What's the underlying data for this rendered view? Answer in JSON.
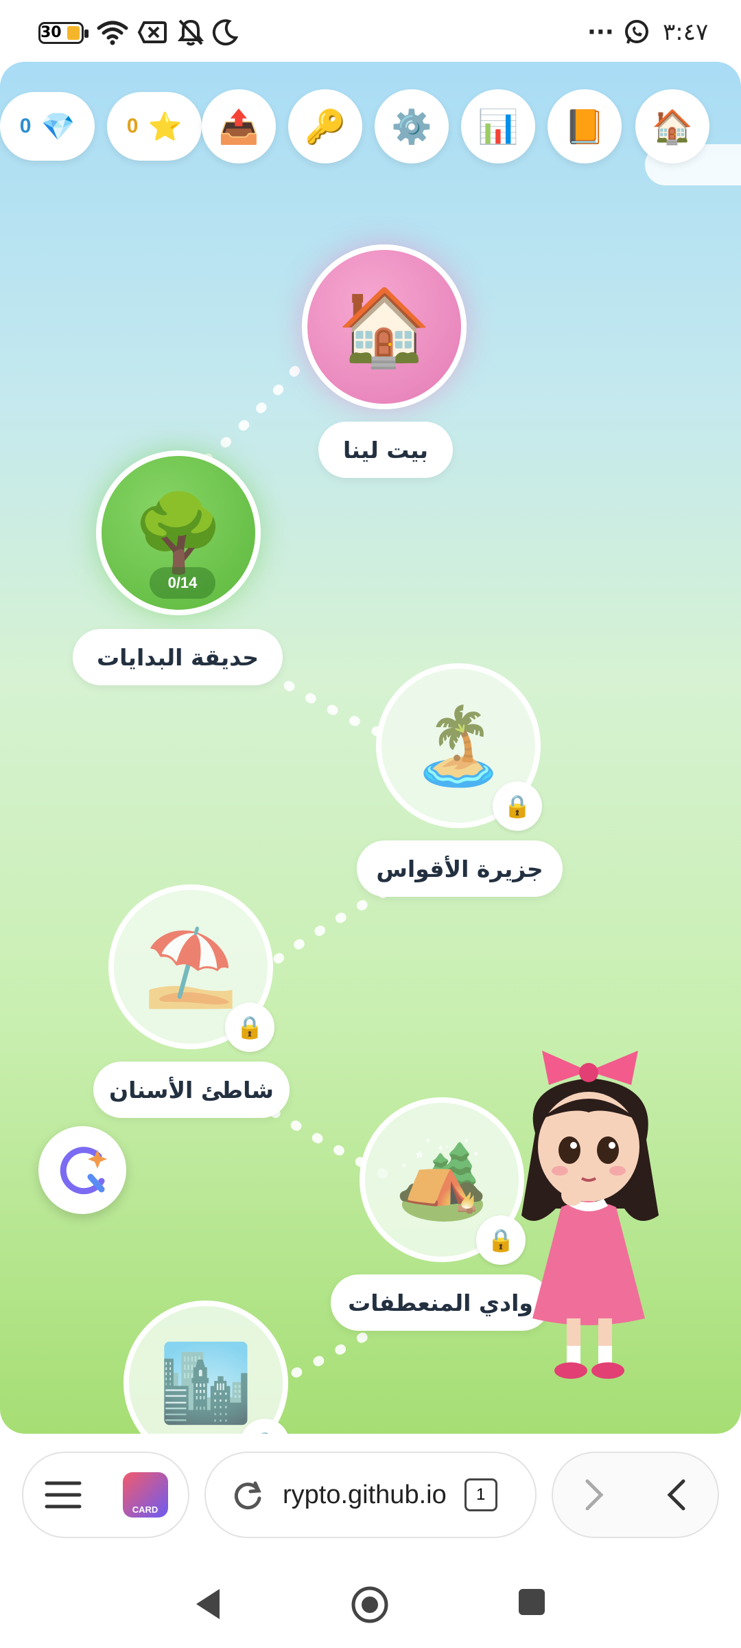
{
  "status_bar": {
    "time": "٣:٤٧",
    "battery": "30",
    "more": "···"
  },
  "toolbar": {
    "gems": "0",
    "stars": "0",
    "icons": [
      "home-icon",
      "book-icon",
      "chart-icon",
      "gear-icon",
      "key-icon",
      "upload-tray-icon",
      "star-icon",
      "gem-icon"
    ]
  },
  "map": {
    "levels": [
      {
        "name": "بيت لينا",
        "state": "current"
      },
      {
        "name": "حديقة البدايات",
        "progress": "0/14",
        "state": "unlocked"
      },
      {
        "name": "جزيرة الأقواس",
        "state": "locked"
      },
      {
        "name": "شاطئ الأسنان",
        "state": "locked"
      },
      {
        "name": "وادي المنعطفات",
        "state": "locked"
      },
      {
        "name": "",
        "state": "locked"
      }
    ]
  },
  "browser": {
    "url": "rypto.github.io",
    "tab_count": "1",
    "app_badge": "CARD"
  },
  "colors": {
    "home_node": "#e47cb6",
    "garden_node": "#5cb83c",
    "label_text": "#233040",
    "stars_num": "#e0a31c",
    "gems_num": "#2c8ed0"
  }
}
